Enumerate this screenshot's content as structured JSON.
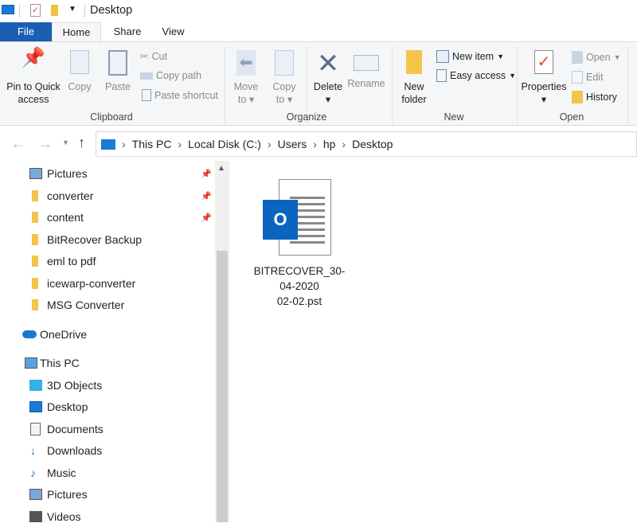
{
  "window": {
    "title": "Desktop"
  },
  "tabs": [
    {
      "label": "File"
    },
    {
      "label": "Home"
    },
    {
      "label": "Share"
    },
    {
      "label": "View"
    }
  ],
  "ribbon": {
    "clipboard": {
      "label": "Clipboard",
      "pin": "Pin to Quick access",
      "pin1": "Pin to Quick",
      "pin2": "access",
      "copy": "Copy",
      "paste": "Paste",
      "cut": "Cut",
      "copy_path": "Copy path",
      "paste_shortcut": "Paste shortcut"
    },
    "organize": {
      "label": "Organize",
      "move1": "Move",
      "move2": "to",
      "copy1": "Copy",
      "copy2": "to",
      "delete": "Delete",
      "rename": "Rename"
    },
    "new": {
      "label": "New",
      "new1": "New",
      "new2": "folder",
      "new_item": "New item",
      "easy_access": "Easy access"
    },
    "open": {
      "label": "Open",
      "properties": "Properties",
      "open": "Open",
      "edit": "Edit",
      "history": "History"
    }
  },
  "address": {
    "path": [
      "This PC",
      "Local Disk (C:)",
      "Users",
      "hp",
      "Desktop"
    ]
  },
  "nav": {
    "quick": [
      {
        "label": "Pictures",
        "pinned": true
      },
      {
        "label": "converter",
        "pinned": true
      },
      {
        "label": "content",
        "pinned": true
      },
      {
        "label": "BitRecover Backup"
      },
      {
        "label": "eml to pdf"
      },
      {
        "label": "icewarp-converter"
      },
      {
        "label": "MSG Converter"
      }
    ],
    "onedrive": "OneDrive",
    "thispc": "This PC",
    "pc_items": [
      {
        "label": "3D Objects"
      },
      {
        "label": "Desktop"
      },
      {
        "label": "Documents"
      },
      {
        "label": "Downloads"
      },
      {
        "label": "Music"
      },
      {
        "label": "Pictures"
      },
      {
        "label": "Videos"
      }
    ]
  },
  "files": [
    {
      "name_lines": [
        "BITRECOVER_30-",
        "04-2020",
        "02-02.pst"
      ],
      "icon_letter": "O"
    }
  ],
  "colors": {
    "accent": "#1a5fb4",
    "folder": "#f0c040"
  }
}
